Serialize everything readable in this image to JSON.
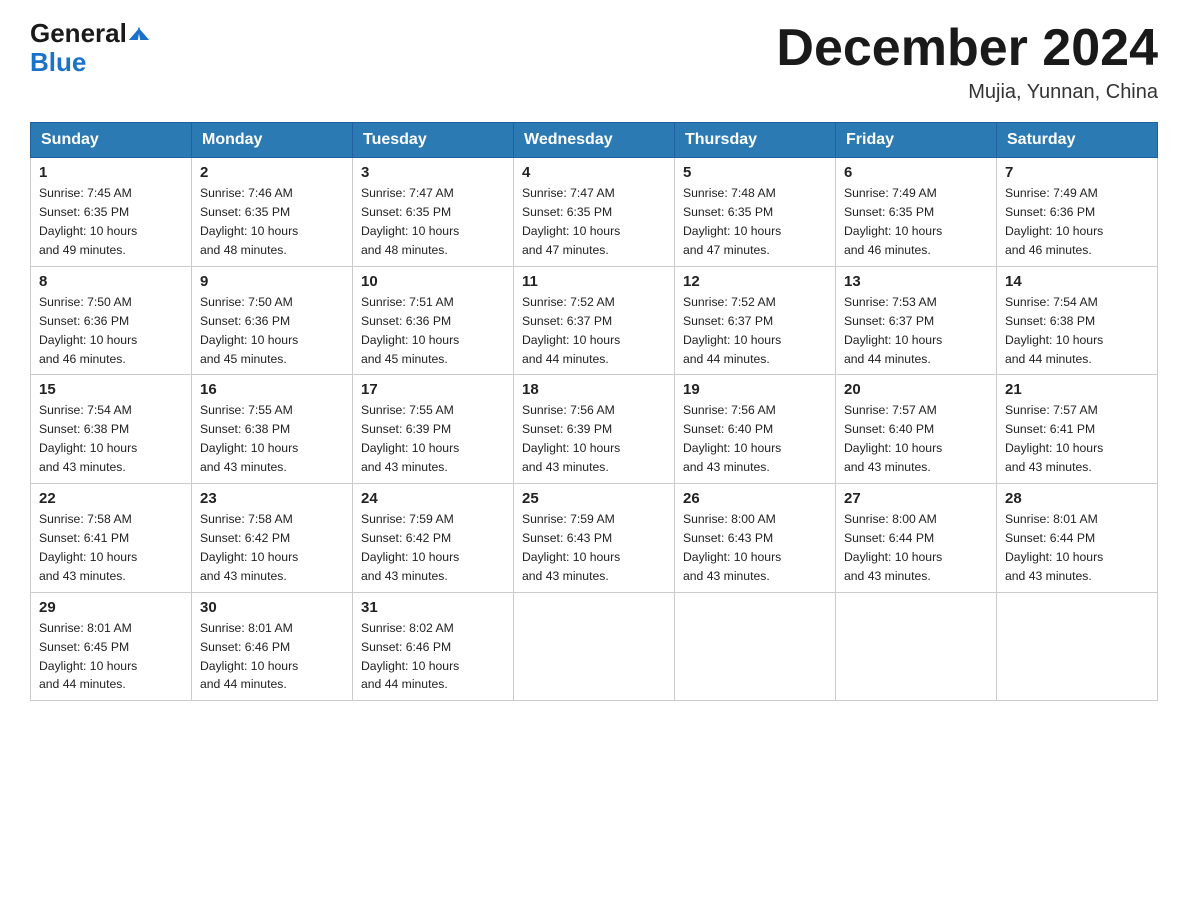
{
  "header": {
    "logo_line1": "General",
    "logo_line2": "Blue",
    "month_title": "December 2024",
    "location": "Mujia, Yunnan, China"
  },
  "days_of_week": [
    "Sunday",
    "Monday",
    "Tuesday",
    "Wednesday",
    "Thursday",
    "Friday",
    "Saturday"
  ],
  "weeks": [
    [
      {
        "day": "1",
        "sunrise": "7:45 AM",
        "sunset": "6:35 PM",
        "daylight": "10 hours and 49 minutes."
      },
      {
        "day": "2",
        "sunrise": "7:46 AM",
        "sunset": "6:35 PM",
        "daylight": "10 hours and 48 minutes."
      },
      {
        "day": "3",
        "sunrise": "7:47 AM",
        "sunset": "6:35 PM",
        "daylight": "10 hours and 48 minutes."
      },
      {
        "day": "4",
        "sunrise": "7:47 AM",
        "sunset": "6:35 PM",
        "daylight": "10 hours and 47 minutes."
      },
      {
        "day": "5",
        "sunrise": "7:48 AM",
        "sunset": "6:35 PM",
        "daylight": "10 hours and 47 minutes."
      },
      {
        "day": "6",
        "sunrise": "7:49 AM",
        "sunset": "6:35 PM",
        "daylight": "10 hours and 46 minutes."
      },
      {
        "day": "7",
        "sunrise": "7:49 AM",
        "sunset": "6:36 PM",
        "daylight": "10 hours and 46 minutes."
      }
    ],
    [
      {
        "day": "8",
        "sunrise": "7:50 AM",
        "sunset": "6:36 PM",
        "daylight": "10 hours and 46 minutes."
      },
      {
        "day": "9",
        "sunrise": "7:50 AM",
        "sunset": "6:36 PM",
        "daylight": "10 hours and 45 minutes."
      },
      {
        "day": "10",
        "sunrise": "7:51 AM",
        "sunset": "6:36 PM",
        "daylight": "10 hours and 45 minutes."
      },
      {
        "day": "11",
        "sunrise": "7:52 AM",
        "sunset": "6:37 PM",
        "daylight": "10 hours and 44 minutes."
      },
      {
        "day": "12",
        "sunrise": "7:52 AM",
        "sunset": "6:37 PM",
        "daylight": "10 hours and 44 minutes."
      },
      {
        "day": "13",
        "sunrise": "7:53 AM",
        "sunset": "6:37 PM",
        "daylight": "10 hours and 44 minutes."
      },
      {
        "day": "14",
        "sunrise": "7:54 AM",
        "sunset": "6:38 PM",
        "daylight": "10 hours and 44 minutes."
      }
    ],
    [
      {
        "day": "15",
        "sunrise": "7:54 AM",
        "sunset": "6:38 PM",
        "daylight": "10 hours and 43 minutes."
      },
      {
        "day": "16",
        "sunrise": "7:55 AM",
        "sunset": "6:38 PM",
        "daylight": "10 hours and 43 minutes."
      },
      {
        "day": "17",
        "sunrise": "7:55 AM",
        "sunset": "6:39 PM",
        "daylight": "10 hours and 43 minutes."
      },
      {
        "day": "18",
        "sunrise": "7:56 AM",
        "sunset": "6:39 PM",
        "daylight": "10 hours and 43 minutes."
      },
      {
        "day": "19",
        "sunrise": "7:56 AM",
        "sunset": "6:40 PM",
        "daylight": "10 hours and 43 minutes."
      },
      {
        "day": "20",
        "sunrise": "7:57 AM",
        "sunset": "6:40 PM",
        "daylight": "10 hours and 43 minutes."
      },
      {
        "day": "21",
        "sunrise": "7:57 AM",
        "sunset": "6:41 PM",
        "daylight": "10 hours and 43 minutes."
      }
    ],
    [
      {
        "day": "22",
        "sunrise": "7:58 AM",
        "sunset": "6:41 PM",
        "daylight": "10 hours and 43 minutes."
      },
      {
        "day": "23",
        "sunrise": "7:58 AM",
        "sunset": "6:42 PM",
        "daylight": "10 hours and 43 minutes."
      },
      {
        "day": "24",
        "sunrise": "7:59 AM",
        "sunset": "6:42 PM",
        "daylight": "10 hours and 43 minutes."
      },
      {
        "day": "25",
        "sunrise": "7:59 AM",
        "sunset": "6:43 PM",
        "daylight": "10 hours and 43 minutes."
      },
      {
        "day": "26",
        "sunrise": "8:00 AM",
        "sunset": "6:43 PM",
        "daylight": "10 hours and 43 minutes."
      },
      {
        "day": "27",
        "sunrise": "8:00 AM",
        "sunset": "6:44 PM",
        "daylight": "10 hours and 43 minutes."
      },
      {
        "day": "28",
        "sunrise": "8:01 AM",
        "sunset": "6:44 PM",
        "daylight": "10 hours and 43 minutes."
      }
    ],
    [
      {
        "day": "29",
        "sunrise": "8:01 AM",
        "sunset": "6:45 PM",
        "daylight": "10 hours and 44 minutes."
      },
      {
        "day": "30",
        "sunrise": "8:01 AM",
        "sunset": "6:46 PM",
        "daylight": "10 hours and 44 minutes."
      },
      {
        "day": "31",
        "sunrise": "8:02 AM",
        "sunset": "6:46 PM",
        "daylight": "10 hours and 44 minutes."
      },
      null,
      null,
      null,
      null
    ]
  ],
  "labels": {
    "sunrise": "Sunrise:",
    "sunset": "Sunset:",
    "daylight": "Daylight:"
  }
}
